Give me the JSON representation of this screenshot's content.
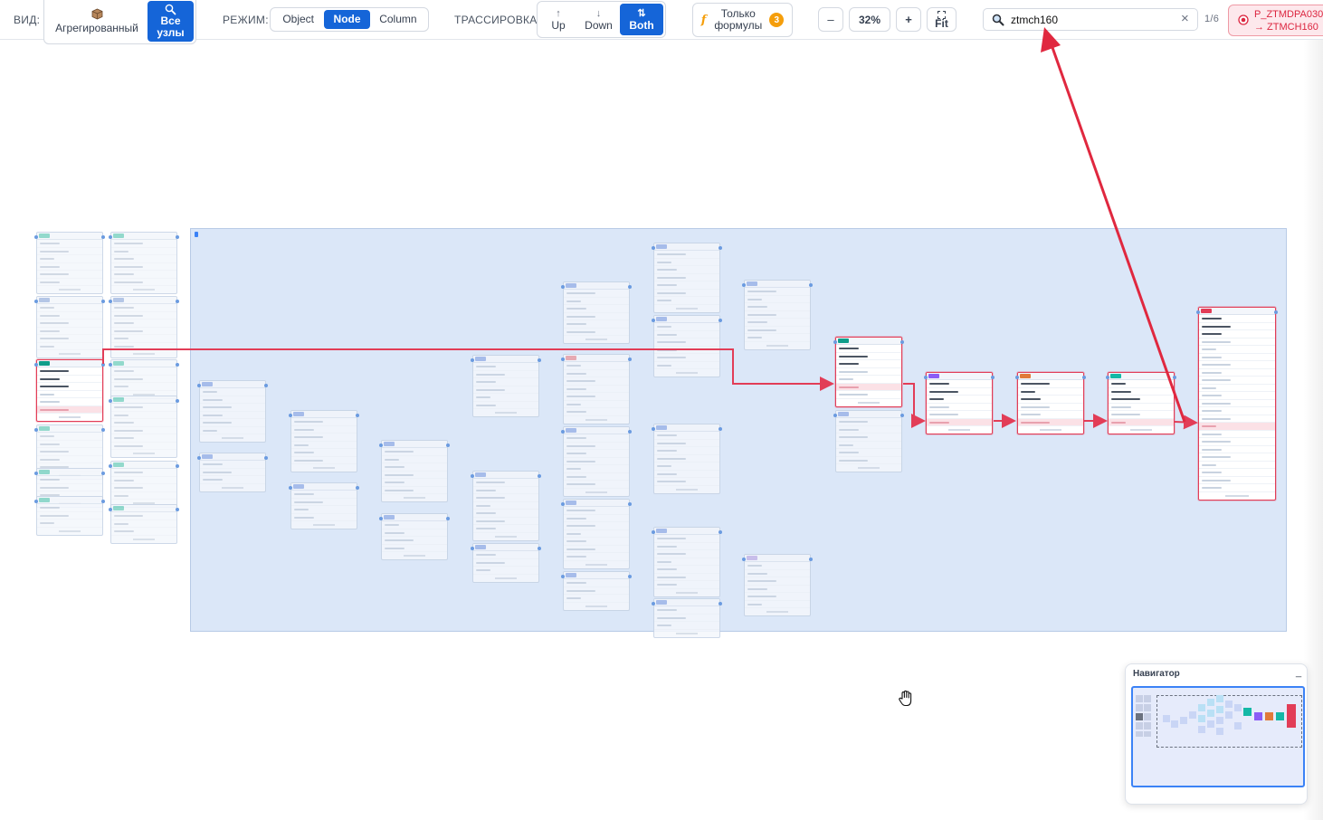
{
  "toolbar": {
    "view_label": "ВИД:",
    "view_options": [
      {
        "icon": "cube-icon",
        "label": "Агрегированный",
        "active": false
      },
      {
        "icon": "magnifier-icon",
        "label_lines": [
          "Все",
          "узлы"
        ],
        "active": true
      }
    ],
    "mode_label": "РЕЖИМ:",
    "mode_options": [
      {
        "label": "Object",
        "active": false
      },
      {
        "label": "Node",
        "active": true
      },
      {
        "label": "Column",
        "active": false
      }
    ],
    "trace_label": "ТРАССИРОВКА:",
    "trace_options": [
      {
        "arrow": "↑",
        "label": "Up",
        "active": false
      },
      {
        "arrow": "↓",
        "label": "Down",
        "active": false
      },
      {
        "arrow": "⇅",
        "label": "Both",
        "active": true
      }
    ],
    "formulas": {
      "icon": "f",
      "label_lines": [
        "Только",
        "формулы"
      ],
      "count": "3"
    },
    "zoom": {
      "minus": "–",
      "value": "32%",
      "plus": "+",
      "fit": "Fit"
    },
    "search": {
      "value": "ztmch160",
      "clear": "×",
      "counter": "1/6"
    },
    "result_chip": {
      "line1": "P_ZTMDPA030",
      "line2": "→ ZTMCH160"
    }
  },
  "navigator": {
    "title": "Навигатор",
    "minimize": "_"
  },
  "colors": {
    "accent": "#1565d8",
    "highlight": "#e23d57",
    "group_bg": "#dbe7f8",
    "badge": "#f59e0b"
  }
}
